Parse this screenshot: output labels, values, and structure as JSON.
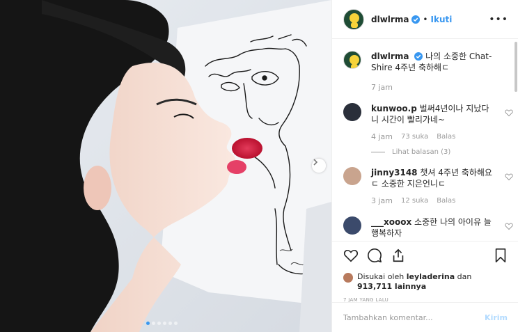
{
  "post": {
    "photo_alt": "",
    "carousel": {
      "dot_count": 6,
      "active_index": 0
    }
  },
  "header": {
    "username": "dlwlrma",
    "separator": "•",
    "follow_label": "Ikuti",
    "more_label": "•••"
  },
  "caption": {
    "username": "dlwlrma",
    "text": "나의 소중한 Chat-Shire 4주년 축하해ㄷ",
    "time": "7 jam"
  },
  "comments": [
    {
      "username": "kunwoo.p",
      "text": "벌써4년이나 지났다니 시간이 빨리가네~",
      "time": "4 jam",
      "likes": "73 suka",
      "reply_label": "Balas",
      "view_replies": "Lihat balasan (3)"
    },
    {
      "username": "jinny3148",
      "text": "챗셔 4주년 축하해요ㄷ 소중한 지은언니ㄷ",
      "time": "3 jam",
      "likes": "12 suka",
      "reply_label": "Balas"
    },
    {
      "username": "___xooox",
      "text": "소중한 나의 아이유 늘 행복하자",
      "time": "",
      "likes": "",
      "reply_label": ""
    }
  ],
  "actions": {
    "liked_by_prefix": "Disukai oleh ",
    "liked_by_user": "leyladerina",
    "liked_by_and": " dan ",
    "liked_by_count": "913,711 lainnya",
    "posted_ago": "7 JAM YANG LALU"
  },
  "comment_box": {
    "placeholder": "Tambahkan komentar...",
    "post_label": "Kirim"
  },
  "colors": {
    "accent": "#3897f0",
    "post_disabled": "#b3dbff",
    "muted": "#999999"
  }
}
